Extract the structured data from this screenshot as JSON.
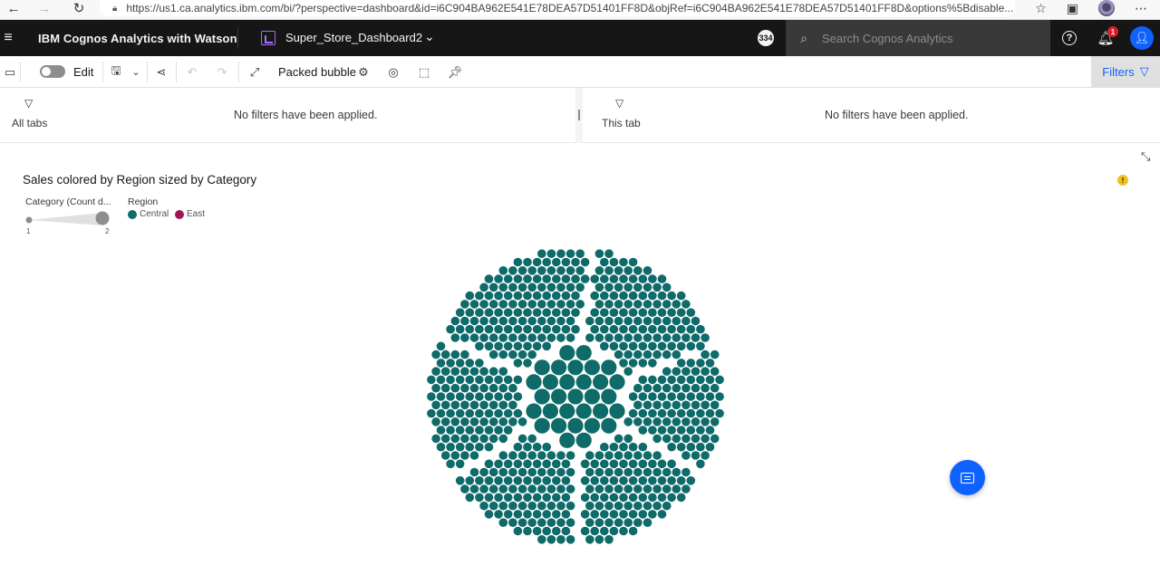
{
  "browser": {
    "url": "https://us1.ca.analytics.ibm.com/bi/?perspective=dashboard&id=i6C904BA962E541E78DEA57D51401FF8D&objRef=i6C904BA962E541E78DEA57D51401FF8D&options%5Bdisable..."
  },
  "header": {
    "brand": "IBM Cognos Analytics with Watson",
    "dashboard_name": "Super_Store_Dashboard2",
    "user_count_badge": "334",
    "search_placeholder": "Search Cognos Analytics",
    "notification_count": "1"
  },
  "toolbar": {
    "edit_label": "Edit",
    "visualization_type": "Packed bubble",
    "filters_label": "Filters"
  },
  "filters": {
    "all_tabs_label": "All tabs",
    "all_tabs_message": "No filters have been applied.",
    "this_tab_label": "This tab",
    "this_tab_message": "No filters have been applied."
  },
  "widget": {
    "title": "Sales colored by Region sized by Category",
    "size_legend": {
      "title": "Category (Count d...",
      "min": "1",
      "max": "2"
    },
    "color_legend": {
      "title": "Region",
      "items": [
        {
          "label": "Central",
          "color": "#0e6b69"
        },
        {
          "label": "East",
          "color": "#9f1853"
        }
      ]
    }
  },
  "chart_data": {
    "type": "packed bubble",
    "title": "Sales colored by Region sized by Category",
    "color_by": "Region",
    "size_by": "Category (Count d...",
    "size_range": [
      1,
      2
    ],
    "series": [
      {
        "name": "Central",
        "color": "#0e6b69"
      },
      {
        "name": "East",
        "color": "#9f1853"
      }
    ]
  }
}
